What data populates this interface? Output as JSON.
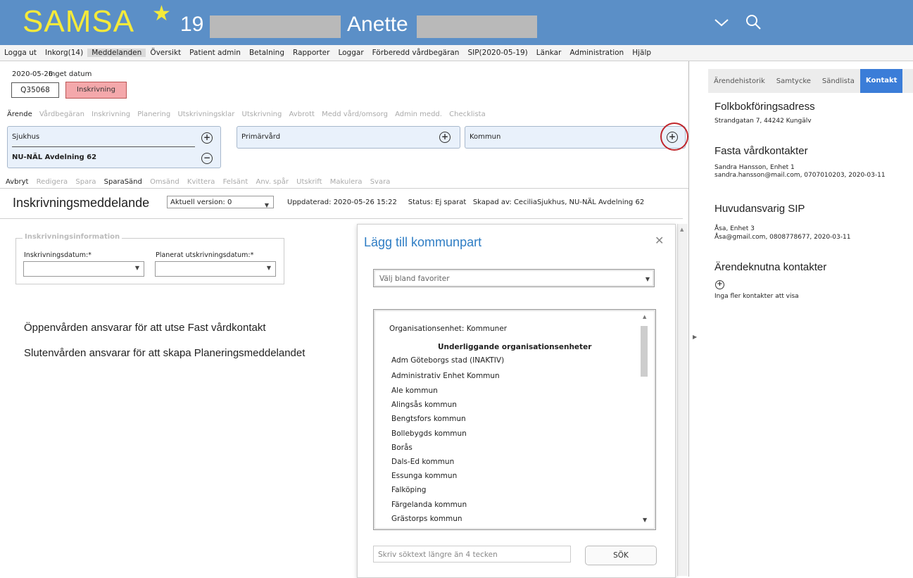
{
  "header": {
    "app_name": "SAMSA",
    "patient_id_prefix": "19",
    "patient_name": "Anette"
  },
  "menu": [
    "Logga ut",
    "Inkorg(14)",
    "Meddelanden",
    "Översikt",
    "Patient admin",
    "Betalning",
    "Rapporter",
    "Loggar",
    "Förberedd vårdbegäran",
    "SIP(2020-05-19)",
    "Länkar",
    "Administration",
    "Hjälp"
  ],
  "case": {
    "date": "2020-05-26",
    "no_date": "Inget datum",
    "case_id": "Q35068",
    "status": "Inskrivning"
  },
  "case_tabs": [
    "Ärende",
    "Vårdbegäran",
    "Inskrivning",
    "Planering",
    "Utskrivningsklar",
    "Utskrivning",
    "Avbrott",
    "Medd vård/omsorg",
    "Admin medd.",
    "Checklista"
  ],
  "parties": {
    "sjukhus": "Sjukhus",
    "sjukhus_unit": "NU-NÄL Avdelning 62",
    "primarvard": "Primärvård",
    "kommun": "Kommun"
  },
  "actions": [
    "Avbryt",
    "Redigera",
    "Spara",
    "SparaSänd",
    "Omsänd",
    "Kvittera",
    "Felsänt",
    "Anv. spår",
    "Utskrift",
    "Makulera",
    "Svara"
  ],
  "document": {
    "title": "Inskrivningsmeddelande",
    "version": "Aktuell version: 0",
    "updated": "Uppdaterad: 2020-05-26 15:22",
    "status": "Status: Ej sparat",
    "created_by": "Skapad av: CeciliaSjukhus, NU-NÄL Avdelning 62"
  },
  "form": {
    "legend": "Inskrivningsinformation",
    "in_label": "Inskrivningsdatum:*",
    "out_label": "Planerat utskrivningsdatum:*"
  },
  "messages": [
    "Öppenvården ansvarar för att utse Fast vårdkontakt",
    "Slutenvården ansvarar för att skapa Planeringsmeddelandet"
  ],
  "modal": {
    "title": "Lägg till kommunpart",
    "favorites_placeholder": "Välj bland favoriter",
    "org_unit": "Organisationsenhet: Kommuner",
    "sub_header": "Underliggande organisationsenheter",
    "items": [
      "Adm Göteborgs stad (INAKTIV)",
      "Administrativ Enhet Kommun",
      "Ale kommun",
      "Alingsås kommun",
      "Bengtsfors kommun",
      "Bollebygds kommun",
      "Borås",
      "Dals-Ed kommun",
      "Essunga kommun",
      "Falköping",
      "Färgelanda kommun",
      "Grästorps kommun"
    ],
    "search_placeholder": "Skriv söktext längre än 4 tecken",
    "search_button": "SÖK"
  },
  "right_tabs": [
    "Ärendehistorik",
    "Samtycke",
    "Sändlista",
    "Kontakt"
  ],
  "right": {
    "folk_title": "Folkbokföringsadress",
    "folk_addr": "Strandgatan 7, 44242 Kungälv",
    "fasta_title": "Fasta vårdkontakter",
    "fasta_line1": "Sandra Hansson, Enhet 1",
    "fasta_line2": "sandra.hansson@mail.com, 0707010203, 2020-03-11",
    "sip_title": "Huvudansvarig SIP",
    "sip_line1": "Åsa, Enhet 3",
    "sip_line2": "Åsa@gmail.com, 0808778677, 2020-03-11",
    "arende_title": "Ärendeknutna kontakter",
    "arende_none": "Inga fler kontakter att visa"
  }
}
